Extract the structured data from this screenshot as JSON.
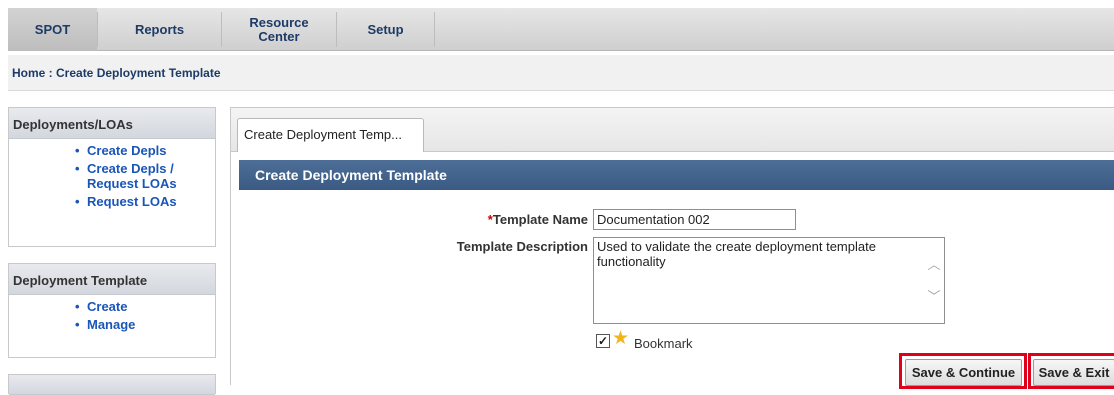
{
  "nav": {
    "items": [
      {
        "label": "SPOT"
      },
      {
        "label": "Reports"
      },
      {
        "label": "Resource Center"
      },
      {
        "label": "Setup"
      }
    ]
  },
  "breadcrumb": "Home : Create Deployment Template",
  "sidebar": {
    "deployments": {
      "title": "Deployments/LOAs",
      "items": [
        "Create Depls",
        "Create Depls / Request LOAs",
        "Request LOAs"
      ]
    },
    "template": {
      "title": "Deployment Template",
      "items": [
        "Create",
        "Manage"
      ]
    }
  },
  "main": {
    "tab_label": "Create Deployment Temp...",
    "section_title": "Create Deployment Template",
    "form": {
      "template_name_required": "*",
      "template_name_label": "Template Name",
      "template_name_value": "Documentation 002",
      "template_description_label": "Template Description",
      "template_description_value": "Used to validate the create deployment template functionality",
      "bookmark_label": "Bookmark",
      "bookmark_checked": true
    },
    "buttons": {
      "save_continue": "Save & Continue",
      "save_exit": "Save & Exit"
    }
  },
  "colors": {
    "section_header": "#3f5f88",
    "link": "#1a56b8",
    "highlight": "#e0001b"
  }
}
